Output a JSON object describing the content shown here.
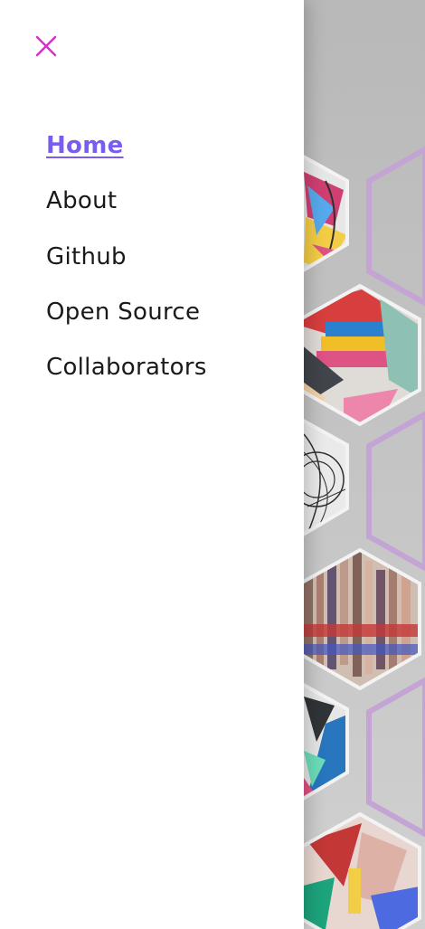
{
  "close_icon": "close-icon",
  "accent_color": "#d631c8",
  "active_color": "#7a5cf0",
  "nav": {
    "items": [
      {
        "label": "Home",
        "active": true
      },
      {
        "label": "About",
        "active": false
      },
      {
        "label": "Github",
        "active": false
      },
      {
        "label": "Open Source",
        "active": false
      },
      {
        "label": "Collaborators",
        "active": false
      }
    ]
  }
}
